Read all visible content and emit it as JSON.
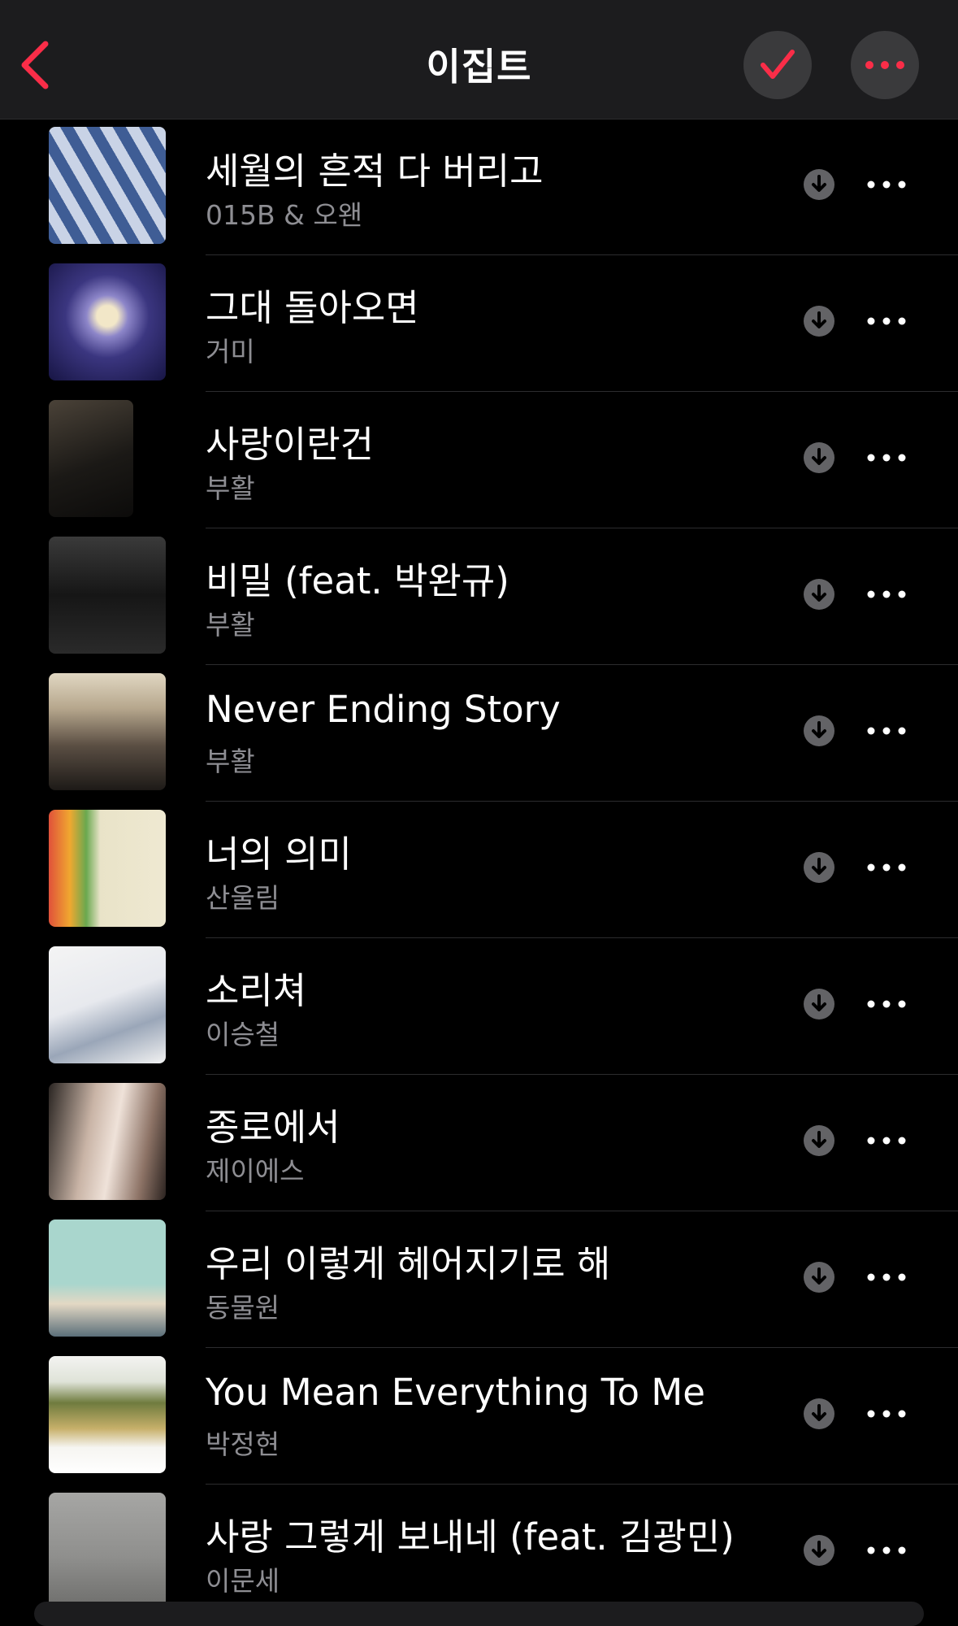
{
  "nav": {
    "title": "이집트",
    "back_icon": "chevron-left-icon",
    "check_icon": "checkmark-icon",
    "more_icon": "ellipsis-icon"
  },
  "colors": {
    "accent": "#fa2d48",
    "secondary_text": "#8e8e93"
  },
  "songs": [
    {
      "title": "세월의 흔적 다 버리고",
      "artist": "015B & 오왠"
    },
    {
      "title": "그대 돌아오면",
      "artist": "거미"
    },
    {
      "title": "사랑이란건",
      "artist": "부활"
    },
    {
      "title": "비밀 (feat. 박완규)",
      "artist": "부활"
    },
    {
      "title": "Never Ending Story",
      "artist": "부활"
    },
    {
      "title": "너의 의미",
      "artist": "산울림"
    },
    {
      "title": "소리쳐",
      "artist": "이승철"
    },
    {
      "title": "종로에서",
      "artist": "제이에스"
    },
    {
      "title": "우리 이렇게 헤어지기로 해",
      "artist": "동물원"
    },
    {
      "title": "You Mean Everything To Me",
      "artist": "박정현"
    },
    {
      "title": "사랑 그렇게 보내네 (feat. 김광민)",
      "artist": "이문세"
    }
  ]
}
